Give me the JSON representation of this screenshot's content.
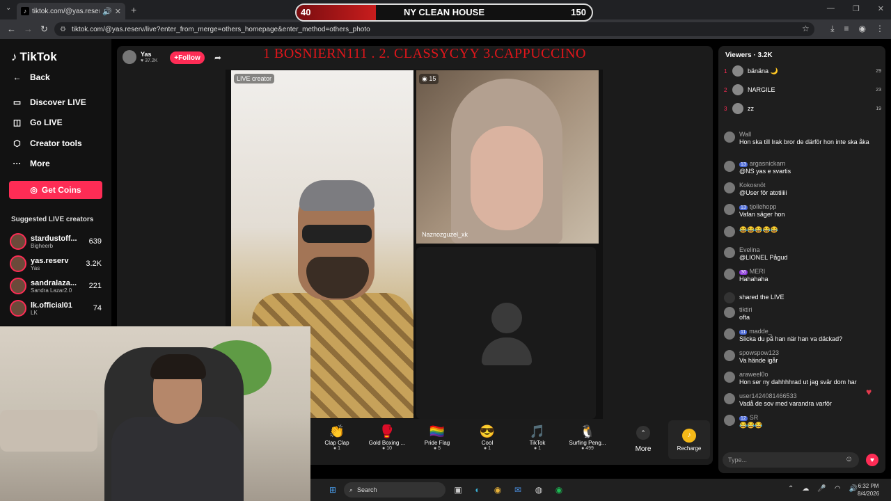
{
  "browser": {
    "tab_title": "tiktok.com/@yas.reserv/live",
    "url": "tiktok.com/@yas.reserv/live?enter_from_merge=others_homepage&enter_method=others_photo"
  },
  "banner": {
    "left": "40",
    "title": "NY CLEAN HOUSE",
    "right": "150",
    "progress": 0.27
  },
  "overlay_title": "1 BOSNIERN111 .  2. CLASSYCYY  3.CAPPUCCINO",
  "sidebar": {
    "logo": "TikTok",
    "items": [
      {
        "label": "Back",
        "icon": "arrow-left-icon"
      },
      {
        "label": "Discover LIVE",
        "icon": "live-icon"
      },
      {
        "label": "Go LIVE",
        "icon": "camera-icon"
      },
      {
        "label": "Creator tools",
        "icon": "tools-icon"
      },
      {
        "label": "More",
        "icon": "ellipsis-icon"
      }
    ],
    "coins": "Get Coins",
    "suggested_title": "Suggested LIVE creators",
    "suggested": [
      {
        "name": "stardustoff...",
        "sub": "Bigheerb",
        "count": "639"
      },
      {
        "name": "yas.reserv",
        "sub": "Yas",
        "count": "3.2K"
      },
      {
        "name": "sandralaza...",
        "sub": "Sandra Lazar2.0",
        "count": "221"
      },
      {
        "name": "lk.official01",
        "sub": "LK",
        "count": "74"
      }
    ]
  },
  "host": {
    "name": "Yas",
    "likes": "37.2K",
    "follow": "Follow"
  },
  "video": {
    "creator_label": "LIVE creator",
    "guest_count": "15",
    "guest_name": "Naznozguzel_xk"
  },
  "gifts": [
    {
      "icon": "👏",
      "name": "Clap Clap",
      "price": "1"
    },
    {
      "icon": "🥊",
      "name": "Gold Boxing ...",
      "price": "10"
    },
    {
      "icon": "🏳️‍🌈",
      "name": "Pride Flag",
      "price": "5"
    },
    {
      "icon": "😎",
      "name": "Cool",
      "price": "1"
    },
    {
      "icon": "🎵",
      "name": "TikTok",
      "price": "1"
    },
    {
      "icon": "🐧",
      "name": "Surfing Peng...",
      "price": "499"
    }
  ],
  "more_label": "More",
  "recharge": "Recharge",
  "viewers": {
    "title": "Viewers · 3.2K",
    "top": [
      {
        "rank": "1",
        "name": "bänäna 🌙",
        "score": "29"
      },
      {
        "rank": "2",
        "name": "NARGILE",
        "score": "23"
      },
      {
        "rank": "3",
        "name": "zz",
        "score": "19"
      }
    ]
  },
  "chat": [
    {
      "user": "Wall",
      "badge": "",
      "text": "Hon ska till Irak bror de därför hon inte ska åka"
    },
    {
      "user": "argasnickarn",
      "badge": "13",
      "text": "@NS yas e svartis"
    },
    {
      "user": "Kokosnöt",
      "badge": "",
      "text": "@User för atotiiiii"
    },
    {
      "user": "tjollehopp",
      "badge": "13",
      "text": "Vafan säger hon"
    },
    {
      "user": "",
      "badge": "",
      "text": "😂😂😂😂😂"
    },
    {
      "user": "Evelina",
      "badge": "",
      "text": "@LIONEL Pågud"
    },
    {
      "user": "MERI",
      "badge": "36",
      "text": "Hahahaha"
    },
    {
      "user": "",
      "badge": "",
      "text": "shared the LIVE"
    },
    {
      "user": "tiktiri",
      "badge": "",
      "text": "ofta"
    },
    {
      "user": "madde_",
      "badge": "11",
      "text": "Slicka du på han när han va däckad?"
    },
    {
      "user": "spowspow123",
      "badge": "",
      "text": "Va hände igår"
    },
    {
      "user": "araweel0o",
      "badge": "",
      "text": "Hon ser ny dahhhhrad ut jag svär dom har"
    },
    {
      "user": "user1424081466533",
      "badge": "",
      "text": "Vadå de sov med varandra varför"
    },
    {
      "user": "SR",
      "badge": "12",
      "text": "😂😂😂"
    }
  ],
  "chat_input": "Type...",
  "taskbar": {
    "search": "Search",
    "time": "6:32 PM",
    "date": "8/4/2026"
  }
}
